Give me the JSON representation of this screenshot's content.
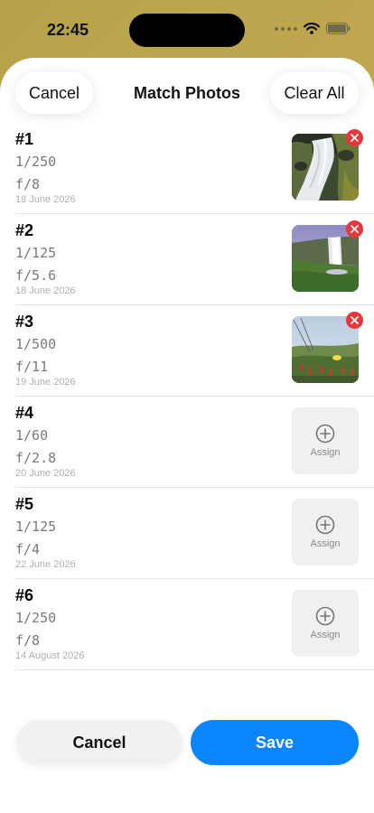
{
  "status": {
    "time": "22:45"
  },
  "nav": {
    "cancel_label": "Cancel",
    "title": "Match Photos",
    "clear_label": "Clear All"
  },
  "rows": [
    {
      "number": "#1",
      "shutter": "1/250",
      "aperture": "f/8",
      "date": "18 June 2026",
      "photo": "waterfall-rocks",
      "assigned": true
    },
    {
      "number": "#2",
      "shutter": "1/125",
      "aperture": "f/5.6",
      "date": "18 June 2026",
      "photo": "waterfall-cliff",
      "assigned": true
    },
    {
      "number": "#3",
      "shutter": "1/500",
      "aperture": "f/11",
      "date": "19 June 2026",
      "photo": "coastal-plants",
      "assigned": true
    },
    {
      "number": "#4",
      "shutter": "1/60",
      "aperture": "f/2.8",
      "date": "20 June 2026",
      "assign_label": "Assign",
      "assigned": false
    },
    {
      "number": "#5",
      "shutter": "1/125",
      "aperture": "f/4",
      "date": "22 June 2026",
      "assign_label": "Assign",
      "assigned": false
    },
    {
      "number": "#6",
      "shutter": "1/250",
      "aperture": "f/8",
      "date": "14 August 2026",
      "assign_label": "Assign",
      "assigned": false
    }
  ],
  "footer": {
    "cancel_label": "Cancel",
    "save_label": "Save"
  },
  "colors": {
    "accent": "#0a84ff",
    "remove": "#e8373b"
  },
  "icons": {
    "remove": "close-circle-icon",
    "assign": "plus-circle-icon",
    "wifi": "wifi-icon",
    "battery": "battery-icon",
    "signal": "signal-dots-icon"
  }
}
